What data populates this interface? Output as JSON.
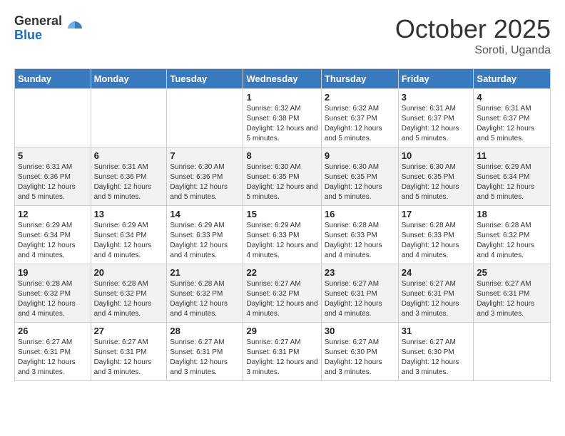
{
  "logo": {
    "general": "General",
    "blue": "Blue"
  },
  "header": {
    "month": "October 2025",
    "location": "Soroti, Uganda"
  },
  "days_of_week": [
    "Sunday",
    "Monday",
    "Tuesday",
    "Wednesday",
    "Thursday",
    "Friday",
    "Saturday"
  ],
  "weeks": [
    [
      {
        "day": "",
        "info": ""
      },
      {
        "day": "",
        "info": ""
      },
      {
        "day": "",
        "info": ""
      },
      {
        "day": "1",
        "info": "Sunrise: 6:32 AM\nSunset: 6:38 PM\nDaylight: 12 hours and 5 minutes."
      },
      {
        "day": "2",
        "info": "Sunrise: 6:32 AM\nSunset: 6:37 PM\nDaylight: 12 hours and 5 minutes."
      },
      {
        "day": "3",
        "info": "Sunrise: 6:31 AM\nSunset: 6:37 PM\nDaylight: 12 hours and 5 minutes."
      },
      {
        "day": "4",
        "info": "Sunrise: 6:31 AM\nSunset: 6:37 PM\nDaylight: 12 hours and 5 minutes."
      }
    ],
    [
      {
        "day": "5",
        "info": "Sunrise: 6:31 AM\nSunset: 6:36 PM\nDaylight: 12 hours and 5 minutes."
      },
      {
        "day": "6",
        "info": "Sunrise: 6:31 AM\nSunset: 6:36 PM\nDaylight: 12 hours and 5 minutes."
      },
      {
        "day": "7",
        "info": "Sunrise: 6:30 AM\nSunset: 6:36 PM\nDaylight: 12 hours and 5 minutes."
      },
      {
        "day": "8",
        "info": "Sunrise: 6:30 AM\nSunset: 6:35 PM\nDaylight: 12 hours and 5 minutes."
      },
      {
        "day": "9",
        "info": "Sunrise: 6:30 AM\nSunset: 6:35 PM\nDaylight: 12 hours and 5 minutes."
      },
      {
        "day": "10",
        "info": "Sunrise: 6:30 AM\nSunset: 6:35 PM\nDaylight: 12 hours and 5 minutes."
      },
      {
        "day": "11",
        "info": "Sunrise: 6:29 AM\nSunset: 6:34 PM\nDaylight: 12 hours and 5 minutes."
      }
    ],
    [
      {
        "day": "12",
        "info": "Sunrise: 6:29 AM\nSunset: 6:34 PM\nDaylight: 12 hours and 4 minutes."
      },
      {
        "day": "13",
        "info": "Sunrise: 6:29 AM\nSunset: 6:34 PM\nDaylight: 12 hours and 4 minutes."
      },
      {
        "day": "14",
        "info": "Sunrise: 6:29 AM\nSunset: 6:33 PM\nDaylight: 12 hours and 4 minutes."
      },
      {
        "day": "15",
        "info": "Sunrise: 6:29 AM\nSunset: 6:33 PM\nDaylight: 12 hours and 4 minutes."
      },
      {
        "day": "16",
        "info": "Sunrise: 6:28 AM\nSunset: 6:33 PM\nDaylight: 12 hours and 4 minutes."
      },
      {
        "day": "17",
        "info": "Sunrise: 6:28 AM\nSunset: 6:33 PM\nDaylight: 12 hours and 4 minutes."
      },
      {
        "day": "18",
        "info": "Sunrise: 6:28 AM\nSunset: 6:32 PM\nDaylight: 12 hours and 4 minutes."
      }
    ],
    [
      {
        "day": "19",
        "info": "Sunrise: 6:28 AM\nSunset: 6:32 PM\nDaylight: 12 hours and 4 minutes."
      },
      {
        "day": "20",
        "info": "Sunrise: 6:28 AM\nSunset: 6:32 PM\nDaylight: 12 hours and 4 minutes."
      },
      {
        "day": "21",
        "info": "Sunrise: 6:28 AM\nSunset: 6:32 PM\nDaylight: 12 hours and 4 minutes."
      },
      {
        "day": "22",
        "info": "Sunrise: 6:27 AM\nSunset: 6:32 PM\nDaylight: 12 hours and 4 minutes."
      },
      {
        "day": "23",
        "info": "Sunrise: 6:27 AM\nSunset: 6:31 PM\nDaylight: 12 hours and 4 minutes."
      },
      {
        "day": "24",
        "info": "Sunrise: 6:27 AM\nSunset: 6:31 PM\nDaylight: 12 hours and 3 minutes."
      },
      {
        "day": "25",
        "info": "Sunrise: 6:27 AM\nSunset: 6:31 PM\nDaylight: 12 hours and 3 minutes."
      }
    ],
    [
      {
        "day": "26",
        "info": "Sunrise: 6:27 AM\nSunset: 6:31 PM\nDaylight: 12 hours and 3 minutes."
      },
      {
        "day": "27",
        "info": "Sunrise: 6:27 AM\nSunset: 6:31 PM\nDaylight: 12 hours and 3 minutes."
      },
      {
        "day": "28",
        "info": "Sunrise: 6:27 AM\nSunset: 6:31 PM\nDaylight: 12 hours and 3 minutes."
      },
      {
        "day": "29",
        "info": "Sunrise: 6:27 AM\nSunset: 6:31 PM\nDaylight: 12 hours and 3 minutes."
      },
      {
        "day": "30",
        "info": "Sunrise: 6:27 AM\nSunset: 6:30 PM\nDaylight: 12 hours and 3 minutes."
      },
      {
        "day": "31",
        "info": "Sunrise: 6:27 AM\nSunset: 6:30 PM\nDaylight: 12 hours and 3 minutes."
      },
      {
        "day": "",
        "info": ""
      }
    ]
  ]
}
